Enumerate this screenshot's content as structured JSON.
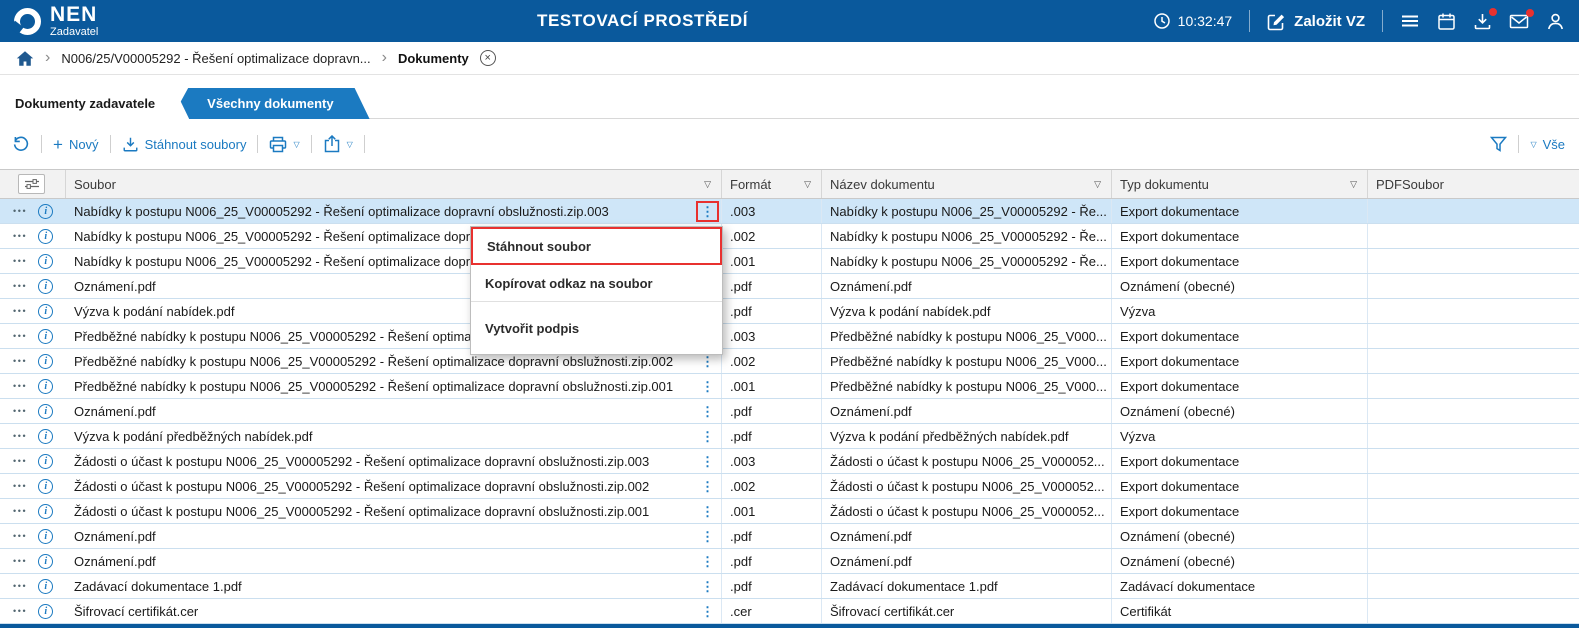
{
  "colors": {
    "header_blue": "#0a599c",
    "accent_blue": "#1b7ac1",
    "selected_row": "#cfe6f8",
    "highlight_red": "#e8312f"
  },
  "icons": {
    "row_actions": "•••",
    "row_menu": "⋮",
    "filter_caret": "▽",
    "dropdown_caret": "▽",
    "breadcrumb_chevron": "›",
    "info": "i",
    "close": "×",
    "plus": "+"
  },
  "header": {
    "brand": "NEN",
    "brand_sub": "Zadavatel",
    "title": "TESTOVACÍ PROSTŘEDÍ",
    "time": "10:32:47",
    "new_vz_label": "Založit VZ"
  },
  "breadcrumb": {
    "procedure": "N006/25/V00005292 - Řešení optimalizace dopravn...",
    "current": "Dokumenty"
  },
  "tabs": [
    {
      "label": "Dokumenty zadavatele",
      "active": true
    },
    {
      "label": "Všechny dokumenty",
      "active": false
    }
  ],
  "toolbar": {
    "new_label": "Nový",
    "download_label": "Stáhnout soubory",
    "view_filter_label": "Vše"
  },
  "table": {
    "columns": [
      "Soubor",
      "Formát",
      "Název dokumentu",
      "Typ dokumentu",
      "PDFSoubor"
    ],
    "rows": [
      {
        "soubor": "Nabídky k postupu N006_25_V00005292 - Řešení optimalizace dopravní obslužnosti.zip.003",
        "format": ".003",
        "nazev": "Nabídky k postupu N006_25_V00005292 - Ře...",
        "typ": "Export dokumentace",
        "selected": true,
        "menu_open": true
      },
      {
        "soubor": "Nabídky k postupu N006_25_V00005292 - Řešení optimalizace dopravní obslužnosti.zip.002",
        "format": ".002",
        "nazev": "Nabídky k postupu N006_25_V00005292 - Ře...",
        "typ": "Export dokumentace"
      },
      {
        "soubor": "Nabídky k postupu N006_25_V00005292 - Řešení optimalizace dopravní obslužnosti.zip.001",
        "format": ".001",
        "nazev": "Nabídky k postupu N006_25_V00005292 - Ře...",
        "typ": "Export dokumentace"
      },
      {
        "soubor": "Oznámení.pdf",
        "format": ".pdf",
        "nazev": "Oznámení.pdf",
        "typ": "Oznámení (obecné)"
      },
      {
        "soubor": "Výzva k podání nabídek.pdf",
        "format": ".pdf",
        "nazev": "Výzva k podání nabídek.pdf",
        "typ": "Výzva"
      },
      {
        "soubor": "Předběžné nabídky k postupu N006_25_V00005292 - Řešení optimalizace dopravní obslužnosti.zip.003",
        "format": ".003",
        "nazev": "Předběžné nabídky k postupu N006_25_V000...",
        "typ": "Export dokumentace"
      },
      {
        "soubor": "Předběžné nabídky k postupu N006_25_V00005292 - Řešení optimalizace dopravní obslužnosti.zip.002",
        "format": ".002",
        "nazev": "Předběžné nabídky k postupu N006_25_V000...",
        "typ": "Export dokumentace"
      },
      {
        "soubor": "Předběžné nabídky k postupu N006_25_V00005292 - Řešení optimalizace dopravní obslužnosti.zip.001",
        "format": ".001",
        "nazev": "Předběžné nabídky k postupu N006_25_V000...",
        "typ": "Export dokumentace"
      },
      {
        "soubor": "Oznámení.pdf",
        "format": ".pdf",
        "nazev": "Oznámení.pdf",
        "typ": "Oznámení (obecné)"
      },
      {
        "soubor": "Výzva k podání předběžných nabídek.pdf",
        "format": ".pdf",
        "nazev": "Výzva k podání předběžných nabídek.pdf",
        "typ": "Výzva"
      },
      {
        "soubor": "Žádosti o účast k postupu N006_25_V00005292 - Řešení optimalizace dopravní obslužnosti.zip.003",
        "format": ".003",
        "nazev": "Žádosti o účast k postupu N006_25_V000052...",
        "typ": "Export dokumentace"
      },
      {
        "soubor": "Žádosti o účast k postupu N006_25_V00005292 - Řešení optimalizace dopravní obslužnosti.zip.002",
        "format": ".002",
        "nazev": "Žádosti o účast k postupu N006_25_V000052...",
        "typ": "Export dokumentace"
      },
      {
        "soubor": "Žádosti o účast k postupu N006_25_V00005292 - Řešení optimalizace dopravní obslužnosti.zip.001",
        "format": ".001",
        "nazev": "Žádosti o účast k postupu N006_25_V000052...",
        "typ": "Export dokumentace"
      },
      {
        "soubor": "Oznámení.pdf",
        "format": ".pdf",
        "nazev": "Oznámení.pdf",
        "typ": "Oznámení (obecné)"
      },
      {
        "soubor": "Oznámení.pdf",
        "format": ".pdf",
        "nazev": "Oznámení.pdf",
        "typ": "Oznámení (obecné)"
      },
      {
        "soubor": "Zadávací dokumentace 1.pdf",
        "format": ".pdf",
        "nazev": "Zadávací dokumentace 1.pdf",
        "typ": "Zadávací dokumentace"
      },
      {
        "soubor": "Šifrovací certifikát.cer",
        "format": ".cer",
        "nazev": "Šifrovací certifikát.cer",
        "typ": "Certifikát"
      }
    ]
  },
  "context_menu": {
    "items": [
      "Stáhnout soubor",
      "Kopírovat odkaz na soubor",
      "Vytvořit podpis"
    ]
  }
}
